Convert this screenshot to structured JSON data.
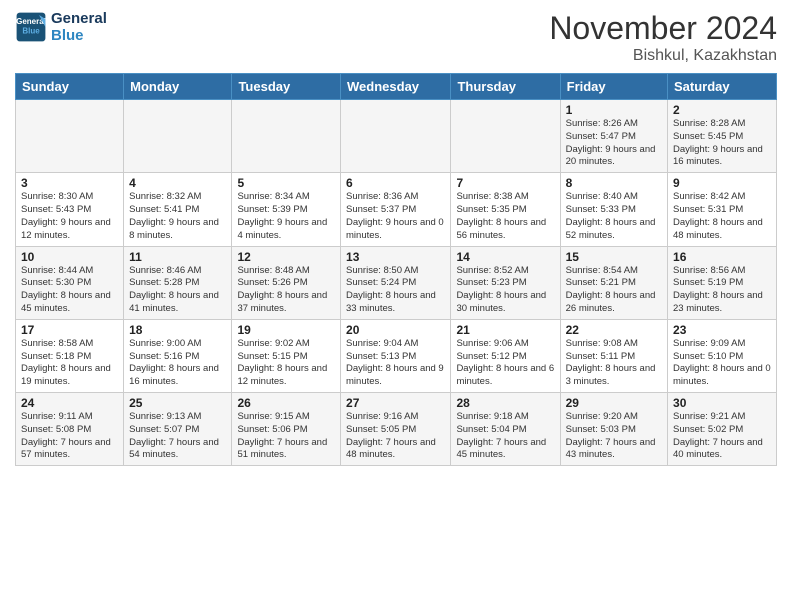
{
  "header": {
    "logo_line1": "General",
    "logo_line2": "Blue",
    "month": "November 2024",
    "location": "Bishkul, Kazakhstan"
  },
  "days_of_week": [
    "Sunday",
    "Monday",
    "Tuesday",
    "Wednesday",
    "Thursday",
    "Friday",
    "Saturday"
  ],
  "weeks": [
    [
      {
        "day": "",
        "info": ""
      },
      {
        "day": "",
        "info": ""
      },
      {
        "day": "",
        "info": ""
      },
      {
        "day": "",
        "info": ""
      },
      {
        "day": "",
        "info": ""
      },
      {
        "day": "1",
        "info": "Sunrise: 8:26 AM\nSunset: 5:47 PM\nDaylight: 9 hours and 20 minutes."
      },
      {
        "day": "2",
        "info": "Sunrise: 8:28 AM\nSunset: 5:45 PM\nDaylight: 9 hours and 16 minutes."
      }
    ],
    [
      {
        "day": "3",
        "info": "Sunrise: 8:30 AM\nSunset: 5:43 PM\nDaylight: 9 hours and 12 minutes."
      },
      {
        "day": "4",
        "info": "Sunrise: 8:32 AM\nSunset: 5:41 PM\nDaylight: 9 hours and 8 minutes."
      },
      {
        "day": "5",
        "info": "Sunrise: 8:34 AM\nSunset: 5:39 PM\nDaylight: 9 hours and 4 minutes."
      },
      {
        "day": "6",
        "info": "Sunrise: 8:36 AM\nSunset: 5:37 PM\nDaylight: 9 hours and 0 minutes."
      },
      {
        "day": "7",
        "info": "Sunrise: 8:38 AM\nSunset: 5:35 PM\nDaylight: 8 hours and 56 minutes."
      },
      {
        "day": "8",
        "info": "Sunrise: 8:40 AM\nSunset: 5:33 PM\nDaylight: 8 hours and 52 minutes."
      },
      {
        "day": "9",
        "info": "Sunrise: 8:42 AM\nSunset: 5:31 PM\nDaylight: 8 hours and 48 minutes."
      }
    ],
    [
      {
        "day": "10",
        "info": "Sunrise: 8:44 AM\nSunset: 5:30 PM\nDaylight: 8 hours and 45 minutes."
      },
      {
        "day": "11",
        "info": "Sunrise: 8:46 AM\nSunset: 5:28 PM\nDaylight: 8 hours and 41 minutes."
      },
      {
        "day": "12",
        "info": "Sunrise: 8:48 AM\nSunset: 5:26 PM\nDaylight: 8 hours and 37 minutes."
      },
      {
        "day": "13",
        "info": "Sunrise: 8:50 AM\nSunset: 5:24 PM\nDaylight: 8 hours and 33 minutes."
      },
      {
        "day": "14",
        "info": "Sunrise: 8:52 AM\nSunset: 5:23 PM\nDaylight: 8 hours and 30 minutes."
      },
      {
        "day": "15",
        "info": "Sunrise: 8:54 AM\nSunset: 5:21 PM\nDaylight: 8 hours and 26 minutes."
      },
      {
        "day": "16",
        "info": "Sunrise: 8:56 AM\nSunset: 5:19 PM\nDaylight: 8 hours and 23 minutes."
      }
    ],
    [
      {
        "day": "17",
        "info": "Sunrise: 8:58 AM\nSunset: 5:18 PM\nDaylight: 8 hours and 19 minutes."
      },
      {
        "day": "18",
        "info": "Sunrise: 9:00 AM\nSunset: 5:16 PM\nDaylight: 8 hours and 16 minutes."
      },
      {
        "day": "19",
        "info": "Sunrise: 9:02 AM\nSunset: 5:15 PM\nDaylight: 8 hours and 12 minutes."
      },
      {
        "day": "20",
        "info": "Sunrise: 9:04 AM\nSunset: 5:13 PM\nDaylight: 8 hours and 9 minutes."
      },
      {
        "day": "21",
        "info": "Sunrise: 9:06 AM\nSunset: 5:12 PM\nDaylight: 8 hours and 6 minutes."
      },
      {
        "day": "22",
        "info": "Sunrise: 9:08 AM\nSunset: 5:11 PM\nDaylight: 8 hours and 3 minutes."
      },
      {
        "day": "23",
        "info": "Sunrise: 9:09 AM\nSunset: 5:10 PM\nDaylight: 8 hours and 0 minutes."
      }
    ],
    [
      {
        "day": "24",
        "info": "Sunrise: 9:11 AM\nSunset: 5:08 PM\nDaylight: 7 hours and 57 minutes."
      },
      {
        "day": "25",
        "info": "Sunrise: 9:13 AM\nSunset: 5:07 PM\nDaylight: 7 hours and 54 minutes."
      },
      {
        "day": "26",
        "info": "Sunrise: 9:15 AM\nSunset: 5:06 PM\nDaylight: 7 hours and 51 minutes."
      },
      {
        "day": "27",
        "info": "Sunrise: 9:16 AM\nSunset: 5:05 PM\nDaylight: 7 hours and 48 minutes."
      },
      {
        "day": "28",
        "info": "Sunrise: 9:18 AM\nSunset: 5:04 PM\nDaylight: 7 hours and 45 minutes."
      },
      {
        "day": "29",
        "info": "Sunrise: 9:20 AM\nSunset: 5:03 PM\nDaylight: 7 hours and 43 minutes."
      },
      {
        "day": "30",
        "info": "Sunrise: 9:21 AM\nSunset: 5:02 PM\nDaylight: 7 hours and 40 minutes."
      }
    ]
  ]
}
